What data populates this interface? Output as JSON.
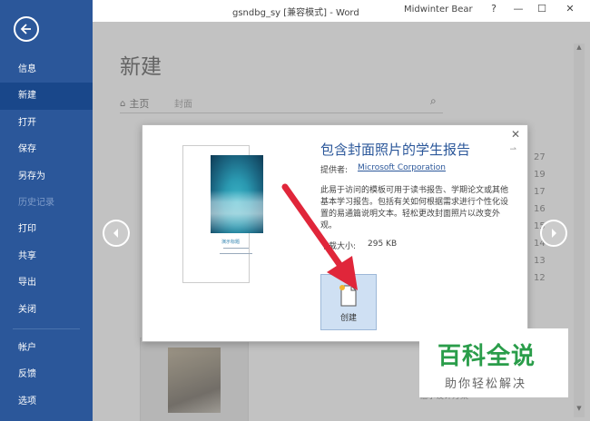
{
  "titlebar": {
    "title": "gsndbg_sy [兼容模式] - Word",
    "user": "Midwinter Bear",
    "help": "?",
    "minimize": "—",
    "restore": "☐",
    "close": "✕"
  },
  "sidebar": {
    "items": [
      {
        "label": "信息"
      },
      {
        "label": "新建"
      },
      {
        "label": "打开"
      },
      {
        "label": "保存"
      },
      {
        "label": "另存为"
      },
      {
        "label": "历史记录"
      },
      {
        "label": "打印"
      },
      {
        "label": "共享"
      },
      {
        "label": "导出"
      },
      {
        "label": "关闭"
      },
      {
        "label": "帐户"
      },
      {
        "label": "反馈"
      },
      {
        "label": "选项"
      }
    ]
  },
  "main": {
    "title": "新建",
    "home": "主页",
    "search_text": "封面",
    "numbers": [
      "27",
      "19",
      "17",
      "16",
      "15",
      "14",
      "13",
      "12"
    ],
    "bg_caption": "福尔设计方案"
  },
  "modal": {
    "title": "包含封面照片的学生报告",
    "provider_label": "提供者:",
    "provider": "Microsoft Corporation",
    "description": "此易于访问的模板可用于读书报告、学期论文或其他基本学习报告。包括有关如何根据需求进行个性化设置的易通篇说明文本。轻松更改封面照片以改变外观。",
    "size_label": "下载大小:",
    "size_value": "295 KB",
    "create_label": "创建",
    "close": "✕",
    "preview_title": "演示标题"
  },
  "watermark": {
    "main": "百科全说",
    "sub": "助你轻松解决"
  },
  "colors": {
    "accent": "#2b579a",
    "watermark": "#2a9d4a",
    "arrow": "#e0263a"
  }
}
